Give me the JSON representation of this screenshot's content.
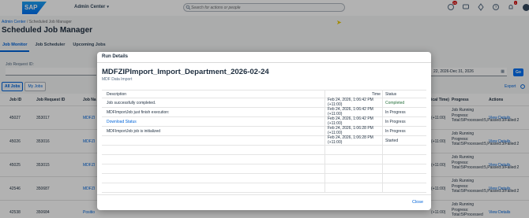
{
  "shell": {
    "logo": "SAP",
    "center_name": "Admin Center",
    "search_placeholder": "Search for actions or people",
    "notification_count": "20",
    "bell_count": "1"
  },
  "breadcrumb": {
    "root": "Admin Center",
    "current": "Scheduled Job Manager"
  },
  "page": {
    "title": "Scheduled Job Manager",
    "tabs": [
      {
        "label": "Job Monitor"
      },
      {
        "label": "Job Scheduler"
      },
      {
        "label": "Upcoming Jobs"
      }
    ],
    "filter_label": "Job Request ID:",
    "date_range": "22, 2026-Dec 31, 2026",
    "go_label": "Go",
    "seg_all": "All Jobs",
    "seg_my": "My Jobs",
    "export_label": "Export"
  },
  "background_table": {
    "columns": [
      "Job ID",
      "Job Request ID",
      "Job Na",
      "ical Time)",
      "Progress",
      "Actions"
    ],
    "rows": [
      {
        "job_id": "45027",
        "request_id": "353017",
        "name": "MDFZI",
        "time": "(+11:00)",
        "progress": "Job Running Progress: Total:5/Processed:5,Passed:3/Failed:2",
        "action": "View Details"
      },
      {
        "job_id": "45026",
        "request_id": "353016",
        "name": "MDFZI",
        "time": "(+11:00)",
        "progress": "Job Running Progress: Total:5/Processed:5,Passed:3/Failed:2",
        "action": "View Details"
      },
      {
        "job_id": "45025",
        "request_id": "353015",
        "name": "MDFZI",
        "time": "(+11:00)",
        "progress": "Job Running Progress: Total:5/Processed:5,Passed:3/Failed:2",
        "action": "View Details"
      },
      {
        "job_id": "42546",
        "request_id": "350687",
        "name": "MDFZI",
        "time": "(+11:00)",
        "progress": "Job Running Progress: Total:5/Processed:5,Passed:3/Failed:2",
        "action": "View Details"
      },
      {
        "job_id": "42538",
        "request_id": "350684",
        "name": "Positio",
        "time": "(+11:00)",
        "progress": "Job Running Progress: Total:5/Processed",
        "action": "View Details"
      }
    ]
  },
  "dialog": {
    "header": "Run Details",
    "title": "MDFZIPImport_Import_Department_2026-02-24",
    "subtitle": "MDF Data Import",
    "columns": {
      "description": "Description",
      "time": "Time",
      "status": "Status"
    },
    "rows": [
      {
        "description": "Job successfully completed.",
        "time_1": "Feb 24, 2026, 1:06:42 PM",
        "time_2": "(+11:00)",
        "status": "Completed"
      },
      {
        "description": "MDFImportJob just finish execution:",
        "time_1": "Feb 24, 2026, 1:06:42 PM",
        "time_2": "(+11:00)",
        "status": "In Progress"
      },
      {
        "description": "Download Status",
        "time_1": "Feb 24, 2026, 1:06:42 PM",
        "time_2": "(+11:00)",
        "status": "In Progress"
      },
      {
        "description": "MDFImportJob job is initialized",
        "time_1": "Feb 24, 2026, 1:06:28 PM",
        "time_2": "(+11:00)",
        "status": "In Progress"
      },
      {
        "description": "",
        "time_1": "Feb 24, 2026, 1:06:28 PM",
        "time_2": "(+11:00)",
        "status": "Started"
      }
    ],
    "close_label": "Close"
  },
  "colors": {
    "accent": "#0064d9",
    "success": "#256f3a",
    "brand_blue": "#0070f2"
  }
}
